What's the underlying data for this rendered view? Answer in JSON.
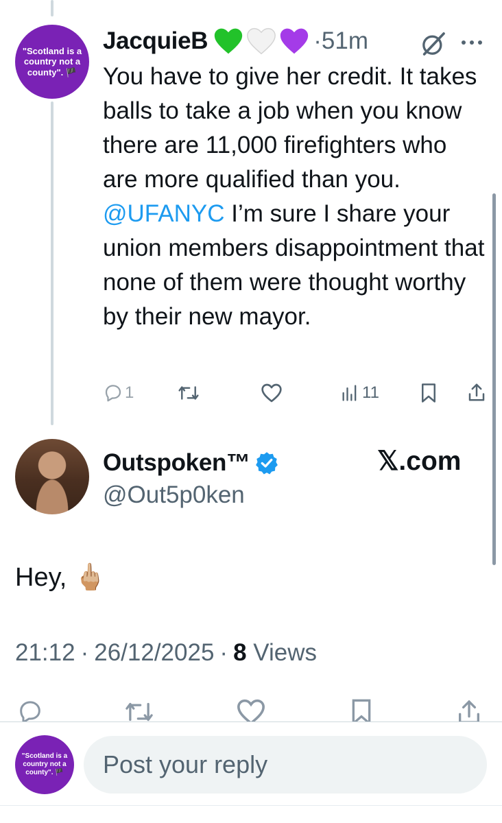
{
  "reply_tweet": {
    "avatar_text": "\"Scotland is a country not a county\". 🏴",
    "display_name": "JacquieB",
    "hearts": [
      "💚",
      "🤍",
      "💜"
    ],
    "separator": "·",
    "time_ago": "51m",
    "text_before_mention": "You have to give her credit.  It takes balls to take a job when you know there are 11,000 firefighters who are more qualified than you.  ",
    "mention": "@UFANYC",
    "text_after_mention": " I’m sure I share your union members disappointment that none of them were thought worthy by their new mayor.",
    "reply_count": "1",
    "views_count": "11",
    "icons": [
      "grok-icon",
      "more-icon",
      "reply-icon",
      "retweet-icon",
      "like-icon",
      "views-icon",
      "bookmark-icon",
      "share-icon"
    ]
  },
  "main_tweet": {
    "display_name": "Outspoken™",
    "handle": "@Out5p0ken",
    "site_badge": "𝕏.com",
    "text": "Hey, 🖕🏼",
    "time": "21:12",
    "date": "26/12/2025",
    "separator": "·",
    "views_count": "8",
    "views_label": "Views",
    "verified_color": "#1d9bf0"
  },
  "reply_composer": {
    "avatar_text": "\"Scotland is a country not a county\". 🏴",
    "placeholder": "Post your reply"
  },
  "colors": {
    "accent": "#1d9bf0",
    "avatar_purple": "#7a22b5",
    "muted": "#536471",
    "heart_green": "#22c22a",
    "heart_purple": "#a43be8"
  }
}
